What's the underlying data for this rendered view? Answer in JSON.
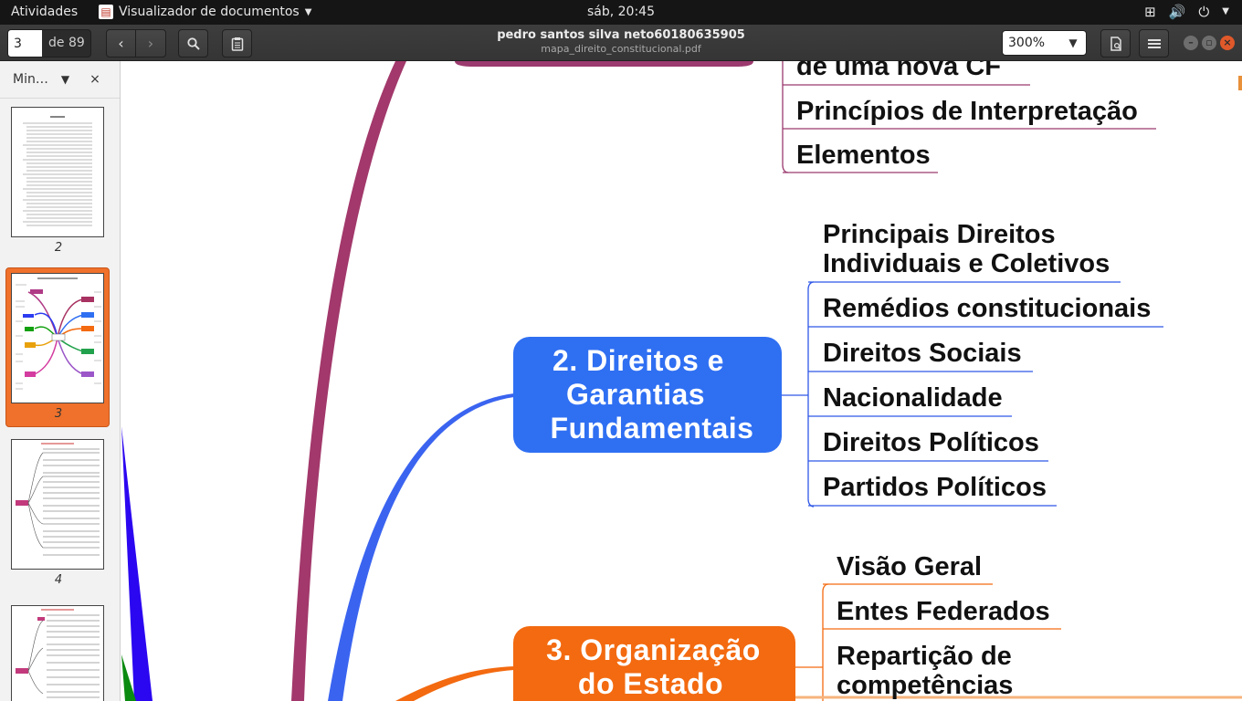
{
  "topbar": {
    "activities": "Atividades",
    "app_name": "Visualizador de documentos",
    "clock": "sáb, 20:45"
  },
  "header": {
    "page_current": "3",
    "page_of": "de 89",
    "doc_title": "pedro santos silva neto60180635905",
    "doc_file": "mapa_direito_constitucional.pdf",
    "zoom": "300%"
  },
  "sidebar": {
    "mode_label": "Min…",
    "thumbs": [
      {
        "num": "2"
      },
      {
        "num": "3"
      },
      {
        "num": "4"
      }
    ]
  },
  "mindmap": {
    "top_leaves": [
      "de uma nova CF",
      "Princípios de Interpretação",
      "Elementos"
    ],
    "node2": {
      "line1": "2. Direitos e",
      "line2": "Garantias",
      "line3": "Fundamentais"
    },
    "node2_leaves": [
      "Principais Direitos",
      "Individuais e Coletivos",
      "Remédios constitucionais",
      "Direitos Sociais",
      "Nacionalidade",
      "Direitos Políticos",
      "Partidos Políticos"
    ],
    "node3": {
      "line1": "3. Organização",
      "line2": "do Estado"
    },
    "node3_leaves": [
      "Visão Geral",
      "Entes Federados",
      "Repartição de",
      "competências"
    ]
  },
  "colors": {
    "node_purple": "#9b3a6e",
    "node_blue": "#2f6ff2",
    "node_orange": "#f36a10"
  }
}
